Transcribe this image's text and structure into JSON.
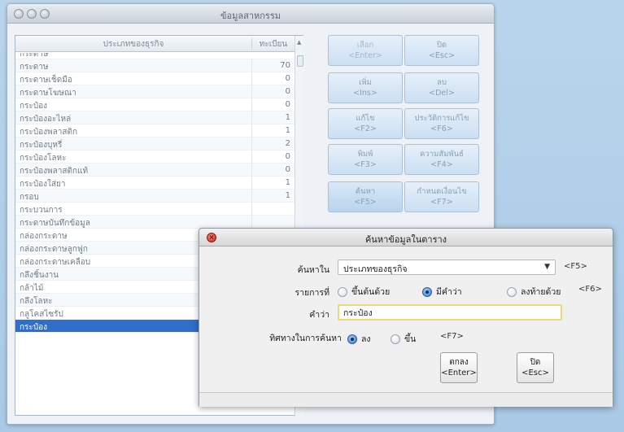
{
  "window": {
    "title": "ข้อมูลสาหกรรม"
  },
  "table": {
    "columns": [
      "ประเภทของธุรกิจ",
      "ทะเบียน"
    ],
    "partial_row": "กระดาษ",
    "rows": [
      {
        "name": "กระดาษ",
        "count": "70"
      },
      {
        "name": "กระดาษเช็ดมือ",
        "count": "0"
      },
      {
        "name": "กระดาษโฆษณา",
        "count": "0"
      },
      {
        "name": "กระป๋อง",
        "count": "0"
      },
      {
        "name": "กระป๋องอะไหล่",
        "count": "1"
      },
      {
        "name": "กระป๋องพลาสติก",
        "count": "1"
      },
      {
        "name": "กระป๋องบุหรี่",
        "count": "2"
      },
      {
        "name": "กระป๋องโลหะ",
        "count": "0"
      },
      {
        "name": "กระป๋องพลาสติกแท้",
        "count": "0"
      },
      {
        "name": "กระป๋องใส่ยา",
        "count": "1"
      },
      {
        "name": "กรอบ",
        "count": "1"
      },
      {
        "name": "กระบวนการ",
        "count": ""
      },
      {
        "name": "กระดาษบันทึกข้อมูล",
        "count": ""
      },
      {
        "name": "กล่องกระดาษ",
        "count": ""
      },
      {
        "name": "กล่องกระดาษลูกฟูก",
        "count": ""
      },
      {
        "name": "กล่องกระดาษเคลือบ",
        "count": ""
      },
      {
        "name": "กลึงชิ้นงาน",
        "count": ""
      },
      {
        "name": "กล้าไม้",
        "count": ""
      },
      {
        "name": "กลึงโลหะ",
        "count": ""
      },
      {
        "name": "กลูโคสไซรัป",
        "count": ""
      },
      {
        "name": "กระป๋อง",
        "count": "",
        "selected": true
      }
    ]
  },
  "actions": {
    "choose": [
      "เลือก",
      "<Enter>"
    ],
    "close": [
      "ปิด",
      "<Esc>"
    ],
    "add": [
      "เพิ่ม",
      "<Ins>"
    ],
    "delete": [
      "ลบ",
      "<Del>"
    ],
    "edit": [
      "แก้ไข",
      "<F2>"
    ],
    "history": [
      "ประวัติการแก้ไข",
      "<F6>"
    ],
    "print": [
      "พิมพ์",
      "<F3>"
    ],
    "relation": [
      "ความสัมพันธ์",
      "<F4>"
    ],
    "search": [
      "ค้นหา",
      "<F5>"
    ],
    "setting": [
      "กำหนดเงื่อนไข",
      "<F7>"
    ]
  },
  "dialog": {
    "title": "ค้นหาข้อมูลในตาราง",
    "search_in_label": "ค้นหาใน",
    "search_in_value": "ประเภทของธุรกิจ",
    "search_in_hotkey": "<F5>",
    "items_label": "รายการที่",
    "match_options": [
      "ขึ้นต้นด้วย",
      "มีคำว่า",
      "ลงท้ายด้วย"
    ],
    "match_selected": "มีคำว่า",
    "match_hotkey": "<F6>",
    "word_label": "คำว่า",
    "word_value": "กระป๋อง",
    "direction_label": "ทิศทางในการค้นหา",
    "direction_options": [
      "ลง",
      "ขึ้น"
    ],
    "direction_selected": "ลง",
    "direction_hotkey": "<F7>",
    "ok": [
      "ตกลง",
      "<Enter>"
    ],
    "cancel": [
      "ปิด",
      "<Esc>"
    ]
  }
}
